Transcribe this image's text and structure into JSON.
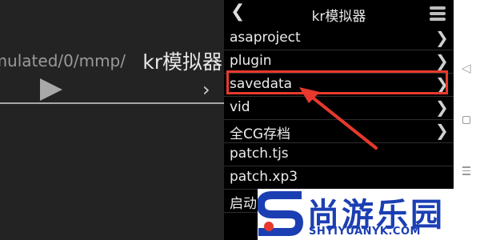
{
  "left_pane": {
    "path_prefix": "mulated/0/mmp/",
    "path_current": "kr模拟器"
  },
  "right_pane": {
    "header_title": "kr模拟器",
    "items": [
      {
        "label": "asaproject",
        "has_chevron": true
      },
      {
        "label": "plugin",
        "has_chevron": true
      },
      {
        "label": "savedata",
        "has_chevron": true
      },
      {
        "label": "vid",
        "has_chevron": true
      },
      {
        "label": "全CG存档",
        "has_chevron": true
      },
      {
        "label": "patch.tjs",
        "has_chevron": false
      },
      {
        "label": "patch.xp3",
        "has_chevron": false
      },
      {
        "label": "启动",
        "has_chevron": false
      }
    ],
    "highlighted_item": "savedata"
  },
  "watermark": {
    "brand": "尚游乐园",
    "url": "SHYIYUANYK.COM"
  },
  "colors": {
    "highlight": "#e8392d",
    "watermark_blue": "#1b3fb3"
  }
}
